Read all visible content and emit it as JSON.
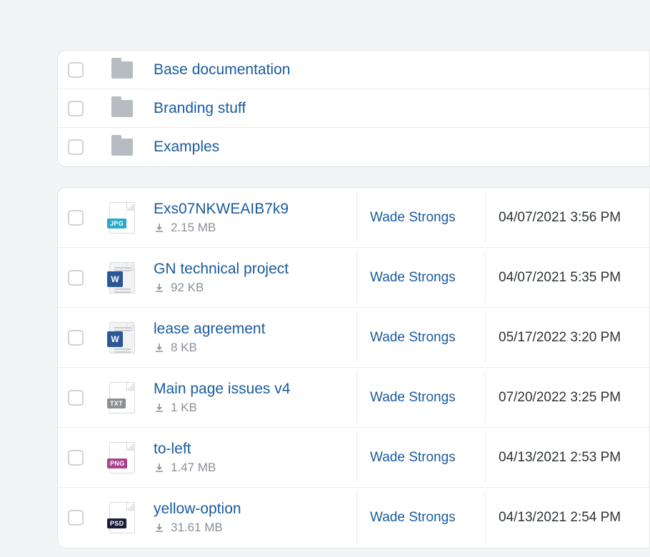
{
  "folders": [
    {
      "name": "Base documentation"
    },
    {
      "name": "Branding stuff"
    },
    {
      "name": "Examples"
    }
  ],
  "files": [
    {
      "name": "Exs07NKWEAIB7k9",
      "size": "2.15 MB",
      "type": "jpg",
      "user": "Wade Strongs",
      "date": "04/07/2021 3:56 PM"
    },
    {
      "name": "GN technical project",
      "size": "92 KB",
      "type": "word",
      "user": "Wade Strongs",
      "date": "04/07/2021 5:35 PM"
    },
    {
      "name": "lease agreement",
      "size": "8 KB",
      "type": "word",
      "user": "Wade Strongs",
      "date": "05/17/2022 3:20 PM"
    },
    {
      "name": "Main page issues v4",
      "size": "1 KB",
      "type": "txt",
      "user": "Wade Strongs",
      "date": "07/20/2022 3:25 PM"
    },
    {
      "name": "to-left",
      "size": "1.47 MB",
      "type": "png",
      "user": "Wade Strongs",
      "date": "04/13/2021 2:53 PM"
    },
    {
      "name": "yellow-option",
      "size": "31.61 MB",
      "type": "psd",
      "user": "Wade Strongs",
      "date": "04/13/2021 2:54 PM"
    }
  ],
  "labels": {
    "word_glyph": "W",
    "jpg_badge": "JPG",
    "txt_badge": "TXT",
    "png_badge": "PNG",
    "psd_badge": "PSD"
  }
}
